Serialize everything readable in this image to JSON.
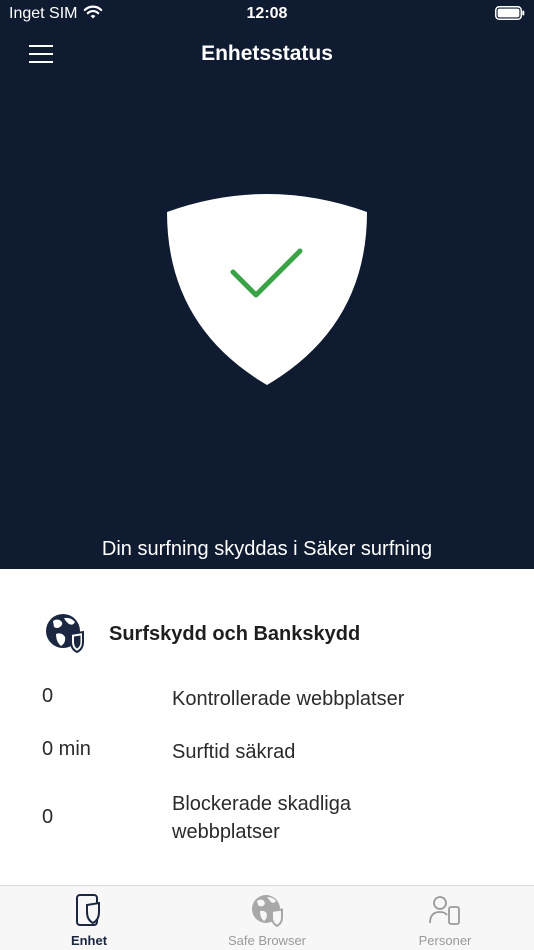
{
  "status_bar": {
    "carrier": "Inget SIM",
    "time": "12:08"
  },
  "header": {
    "title": "Enhetsstatus"
  },
  "hero": {
    "caption": "Din surfning skyddas i Säker surfning"
  },
  "card": {
    "title": "Surfskydd och Bankskydd",
    "rows": [
      {
        "value": "0",
        "label": "Kontrollerade webbplatser"
      },
      {
        "value": "0 min",
        "label": "Surftid säkrad"
      },
      {
        "value": "0",
        "label": "Blockerade skadliga webbplatser"
      }
    ]
  },
  "tabs": [
    {
      "label": "Enhet",
      "icon": "device-shield-icon"
    },
    {
      "label": "Safe Browser",
      "icon": "globe-shield-icon"
    },
    {
      "label": "Personer",
      "icon": "person-device-icon"
    }
  ],
  "colors": {
    "header_bg": "#0f1b30",
    "check_green": "#3aa346",
    "text_dark": "#1e1e1e"
  }
}
